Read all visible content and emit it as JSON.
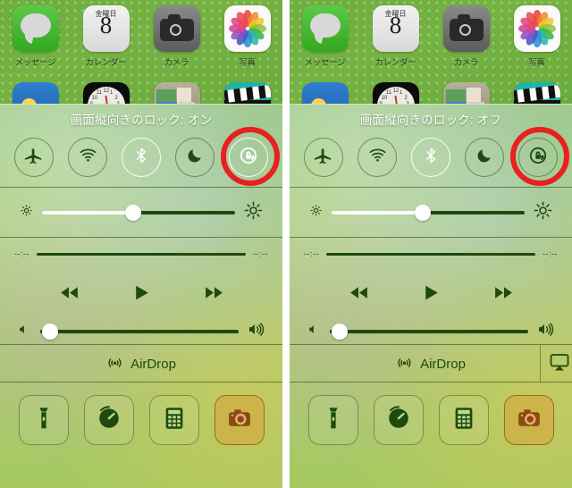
{
  "meta": {
    "description": "iOS Control Center side-by-side comparison of portrait orientation lock ON and OFF",
    "accent_red": "#e8201f",
    "panel_green": "#a5c95f",
    "dark_green": "#1f4a0e"
  },
  "home_screen": {
    "apps_row1": [
      {
        "label": "メッセージ",
        "icon": "messages-icon"
      },
      {
        "label": "カレンダー",
        "icon": "calendar-icon",
        "day_of_week": "金曜日",
        "day_number": "8"
      },
      {
        "label": "カメラ",
        "icon": "camera-icon"
      },
      {
        "label": "写真",
        "icon": "photos-icon"
      }
    ],
    "apps_row2": [
      {
        "label": "",
        "icon": "weather-icon"
      },
      {
        "label": "",
        "icon": "clock-icon"
      },
      {
        "label": "",
        "icon": "newsstand-icon"
      },
      {
        "label": "",
        "icon": "videos-icon"
      }
    ]
  },
  "panels": [
    {
      "id": "left",
      "title": "画面縦向きのロック: オン",
      "toggles": [
        {
          "name": "airplane-mode",
          "icon": "airplane-icon",
          "state": "off"
        },
        {
          "name": "wifi",
          "icon": "wifi-icon",
          "state": "off"
        },
        {
          "name": "bluetooth",
          "icon": "bluetooth-icon",
          "state": "on"
        },
        {
          "name": "do-not-disturb",
          "icon": "moon-icon",
          "state": "off"
        },
        {
          "name": "rotation-lock",
          "icon": "rotation-lock-icon",
          "state": "on",
          "highlighted": true
        }
      ],
      "brightness": {
        "value": 47,
        "icon_low": "brightness-low-icon",
        "icon_high": "brightness-high-icon"
      },
      "media": {
        "elapsed": "--:--",
        "remaining": "--:--",
        "progress": 0,
        "controls": [
          {
            "name": "rewind-button",
            "icon": "rewind-icon"
          },
          {
            "name": "play-button",
            "icon": "play-icon"
          },
          {
            "name": "forward-button",
            "icon": "fast-forward-icon"
          }
        ],
        "volume": {
          "value": 5,
          "icon_low": "volume-low-icon",
          "icon_high": "volume-high-icon"
        }
      },
      "airdrop": {
        "label": "AirDrop",
        "icon": "airdrop-icon"
      },
      "airplay_visible": false,
      "shortcuts": [
        {
          "name": "flashlight",
          "icon": "flashlight-icon"
        },
        {
          "name": "timer",
          "icon": "timer-icon"
        },
        {
          "name": "calculator",
          "icon": "calculator-icon"
        },
        {
          "name": "camera",
          "icon": "camera-shortcut-icon"
        }
      ]
    },
    {
      "id": "right",
      "title": "画面縦向きのロック: オフ",
      "toggles": [
        {
          "name": "airplane-mode",
          "icon": "airplane-icon",
          "state": "off"
        },
        {
          "name": "wifi",
          "icon": "wifi-icon",
          "state": "off"
        },
        {
          "name": "bluetooth",
          "icon": "bluetooth-icon",
          "state": "on"
        },
        {
          "name": "do-not-disturb",
          "icon": "moon-icon",
          "state": "off"
        },
        {
          "name": "rotation-lock",
          "icon": "rotation-lock-icon",
          "state": "off",
          "highlighted": true
        }
      ],
      "brightness": {
        "value": 47,
        "icon_low": "brightness-low-icon",
        "icon_high": "brightness-high-icon"
      },
      "media": {
        "elapsed": "--:--",
        "remaining": "--:--",
        "progress": 0,
        "controls": [
          {
            "name": "rewind-button",
            "icon": "rewind-icon"
          },
          {
            "name": "play-button",
            "icon": "play-icon"
          },
          {
            "name": "forward-button",
            "icon": "fast-forward-icon"
          }
        ],
        "volume": {
          "value": 5,
          "icon_low": "volume-low-icon",
          "icon_high": "volume-high-icon"
        }
      },
      "airdrop": {
        "label": "AirDrop",
        "icon": "airdrop-icon"
      },
      "airplay_visible": true,
      "airplay": {
        "name": "airplay",
        "icon": "airplay-icon"
      },
      "shortcuts": [
        {
          "name": "flashlight",
          "icon": "flashlight-icon"
        },
        {
          "name": "timer",
          "icon": "timer-icon"
        },
        {
          "name": "calculator",
          "icon": "calculator-icon"
        },
        {
          "name": "camera",
          "icon": "camera-shortcut-icon"
        }
      ]
    }
  ]
}
